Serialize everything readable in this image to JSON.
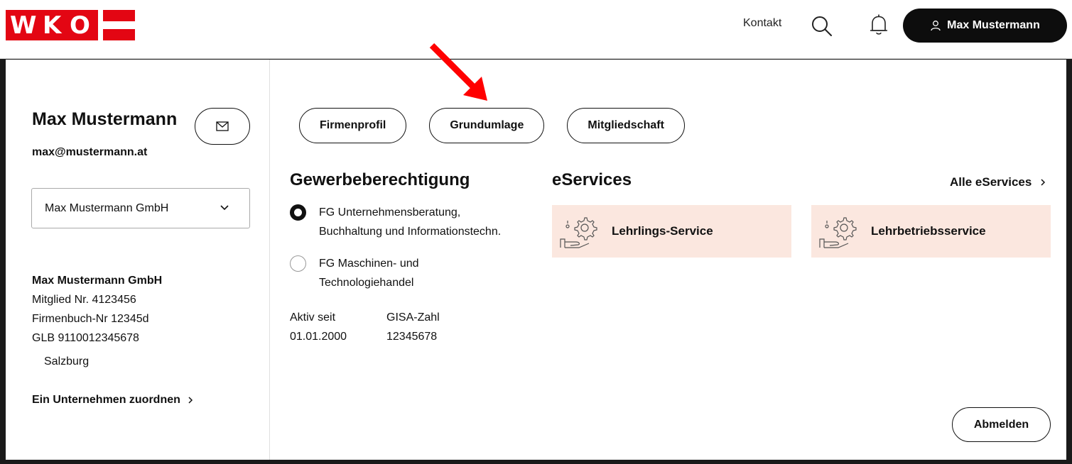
{
  "brand": {
    "logo_letters": [
      "W",
      "K",
      "O"
    ],
    "color": "#e30613"
  },
  "header": {
    "contact_label": "Kontakt",
    "search_icon": "search-icon",
    "bell_icon": "bell-icon",
    "user_label": "Max Mustermann"
  },
  "profile": {
    "name": "Max Mustermann",
    "email": "max@mustermann.at",
    "selected_company": "Max Mustermann GmbH",
    "company_name": "Max Mustermann GmbH",
    "member_no": "Mitglied Nr. 4123456",
    "register_no": "Firmenbuch-Nr 12345d",
    "glb": "GLB 9110012345678",
    "region": "Salzburg",
    "assign_link": "Ein Unternehmen zuordnen"
  },
  "tabs": [
    {
      "label": "Firmenprofil"
    },
    {
      "label": "Grundumlage"
    },
    {
      "label": "Mitgliedschaft"
    }
  ],
  "gewerbe": {
    "title": "Gewerbeberechtigung",
    "options": [
      {
        "line1": "FG Unternehmensberatung,",
        "line2": "Buchhaltung und Informationstechn.",
        "checked": true
      },
      {
        "line1": "FG Maschinen- und",
        "line2": "Technologiehandel",
        "checked": false
      }
    ],
    "active_since_label": "Aktiv seit",
    "active_since_value": "01.01.2000",
    "gisa_label": "GISA-Zahl",
    "gisa_value": "12345678"
  },
  "eservices": {
    "title": "eServices",
    "all_link": "Alle eServices",
    "cards": [
      {
        "label": "Lehrlings-Service"
      },
      {
        "label": "Lehrbetriebsservice"
      }
    ],
    "card_color": "#fbe7df"
  },
  "logout_label": "Abmelden",
  "annotation_color": "#ff0000"
}
